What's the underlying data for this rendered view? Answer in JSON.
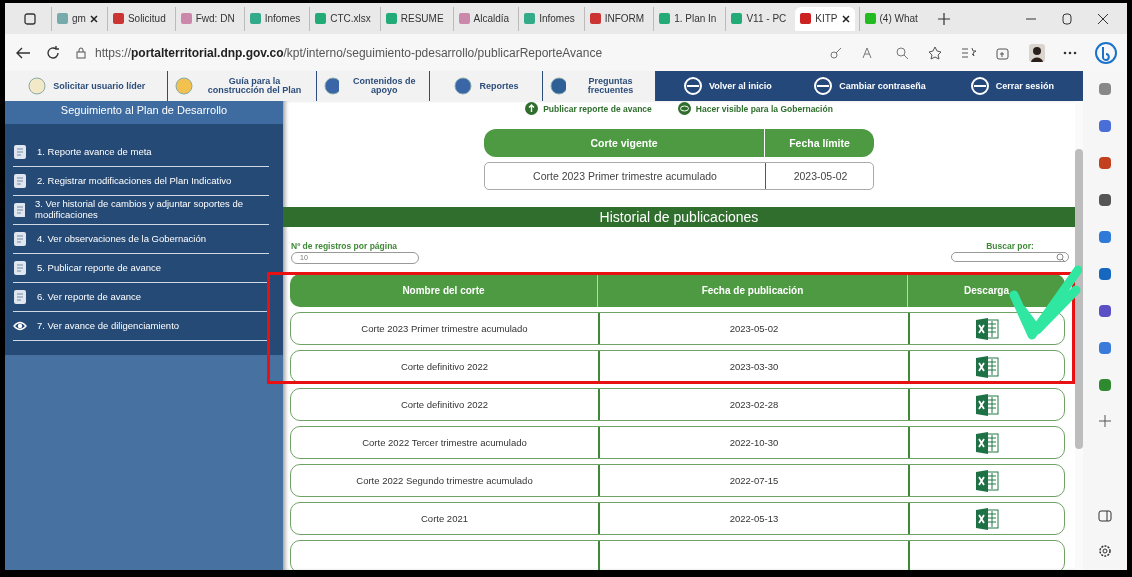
{
  "browser": {
    "tabs": [
      {
        "label": "gm",
        "selected": false,
        "closable": true
      },
      {
        "label": "Solicitud",
        "selected": false,
        "closable": false
      },
      {
        "label": "Fwd: DN",
        "selected": false,
        "closable": false
      },
      {
        "label": "Infomes",
        "selected": false,
        "closable": false
      },
      {
        "label": "CTC.xlsx",
        "selected": false,
        "closable": false
      },
      {
        "label": "RESUME",
        "selected": false,
        "closable": false
      },
      {
        "label": "Alcaldía",
        "selected": false,
        "closable": false
      },
      {
        "label": "Infomes",
        "selected": false,
        "closable": false
      },
      {
        "label": "INFORM",
        "selected": false,
        "closable": false
      },
      {
        "label": "1. Plan In",
        "selected": false,
        "closable": false
      },
      {
        "label": "V11 - PC",
        "selected": false,
        "closable": false
      },
      {
        "label": "KITP",
        "selected": true,
        "closable": true
      },
      {
        "label": "(4) What",
        "selected": false,
        "closable": false
      }
    ],
    "url": "https://**portalterritorial.dnp.gov.co**/kpt/interno/seguimiento-pdesarrollo/publicarReporteAvance"
  },
  "toolbar": [
    {
      "label": "Solicitar usuario líder",
      "kind": "light"
    },
    {
      "label": "Guía para la construcción del Plan",
      "kind": "light"
    },
    {
      "label": "Contenidos de apoyo",
      "kind": "light"
    },
    {
      "label": "Reportes",
      "kind": "light"
    },
    {
      "label": "Preguntas frecuentes",
      "kind": "light"
    },
    {
      "label": "Volver al inicio",
      "kind": "dark"
    },
    {
      "label": "Cambiar contraseña",
      "kind": "dark"
    },
    {
      "label": "Cerrar sesión",
      "kind": "dark"
    }
  ],
  "sidebar": {
    "title": "Seguimiento al Plan de Desarrollo",
    "items": [
      {
        "label": "1. Reporte avance de meta"
      },
      {
        "label": "2. Registrar modificaciones del Plan Indicativo"
      },
      {
        "label": "3. Ver historial de cambios y adjuntar soportes de modificaciones"
      },
      {
        "label": "4. Ver observaciones de la Gobernación"
      },
      {
        "label": "5. Publicar reporte de avance"
      },
      {
        "label": "6. Ver reporte de avance"
      },
      {
        "label": "7. Ver avance de diligenciamiento"
      }
    ]
  },
  "actions": [
    "Publicar reporte de avance",
    "Hacer visible para la Gobernación"
  ],
  "current_cut": {
    "columns": [
      "Corte vigente",
      "Fecha límite"
    ],
    "row": [
      "Corte 2023 Primer trimestre acumulado",
      "2023-05-02"
    ]
  },
  "history": {
    "title": "Historial de publicaciones",
    "page_size": {
      "label": "Nº de registros por página",
      "value": "10"
    },
    "search": {
      "label": "Buscar por:"
    },
    "columns": [
      "Nombre del corte",
      "Fecha de publicación",
      "Descarga"
    ],
    "rows": [
      {
        "name": "Corte 2023 Primer trimestre acumulado",
        "date": "2023-05-02"
      },
      {
        "name": "Corte definitivo 2022",
        "date": "2023-03-30"
      },
      {
        "name": "Corte definitivo 2022",
        "date": "2023-02-28"
      },
      {
        "name": "Corte 2022 Tercer trimestre acumulado",
        "date": "2022-10-30"
      },
      {
        "name": "Corte 2022 Segundo trimestre acumulado",
        "date": "2022-07-15"
      },
      {
        "name": "Corte 2021",
        "date": "2022-05-13"
      }
    ]
  }
}
